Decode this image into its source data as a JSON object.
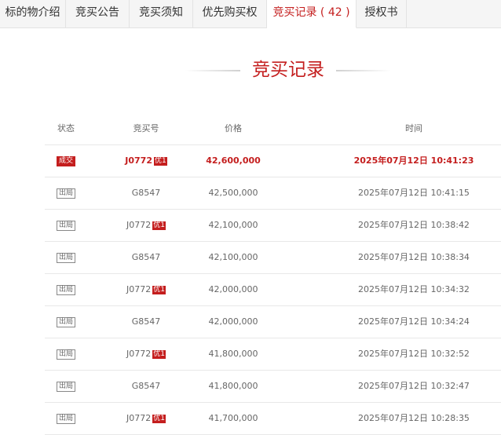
{
  "tabs": [
    {
      "label": "标的物介绍"
    },
    {
      "label": "竞买公告"
    },
    {
      "label": "竞买须知"
    },
    {
      "label": "优先购买权"
    },
    {
      "label": "竞买记录 ( 42 )"
    },
    {
      "label": "授权书"
    }
  ],
  "section": {
    "title": "竞买记录"
  },
  "table": {
    "headers": {
      "status": "状态",
      "bidder": "竞买号",
      "price": "价格",
      "time": "时间"
    },
    "priority_badge": "优1",
    "rows": [
      {
        "status": "成交",
        "bidder": "J0772",
        "priority": true,
        "price": "42,600,000",
        "time": "2025年07月12日 10:41:23",
        "win": true
      },
      {
        "status": "出局",
        "bidder": "G8547",
        "priority": false,
        "price": "42,500,000",
        "time": "2025年07月12日 10:41:15",
        "win": false
      },
      {
        "status": "出局",
        "bidder": "J0772",
        "priority": true,
        "price": "42,100,000",
        "time": "2025年07月12日 10:38:42",
        "win": false
      },
      {
        "status": "出局",
        "bidder": "G8547",
        "priority": false,
        "price": "42,100,000",
        "time": "2025年07月12日 10:38:34",
        "win": false
      },
      {
        "status": "出局",
        "bidder": "J0772",
        "priority": true,
        "price": "42,000,000",
        "time": "2025年07月12日 10:34:32",
        "win": false
      },
      {
        "status": "出局",
        "bidder": "G8547",
        "priority": false,
        "price": "42,000,000",
        "time": "2025年07月12日 10:34:24",
        "win": false
      },
      {
        "status": "出局",
        "bidder": "J0772",
        "priority": true,
        "price": "41,800,000",
        "time": "2025年07月12日 10:32:52",
        "win": false
      },
      {
        "status": "出局",
        "bidder": "G8547",
        "priority": false,
        "price": "41,800,000",
        "time": "2025年07月12日 10:32:47",
        "win": false
      },
      {
        "status": "出局",
        "bidder": "J0772",
        "priority": true,
        "price": "41,700,000",
        "time": "2025年07月12日 10:28:35",
        "win": false
      }
    ]
  },
  "colors": {
    "accent": "#c41e1e"
  }
}
